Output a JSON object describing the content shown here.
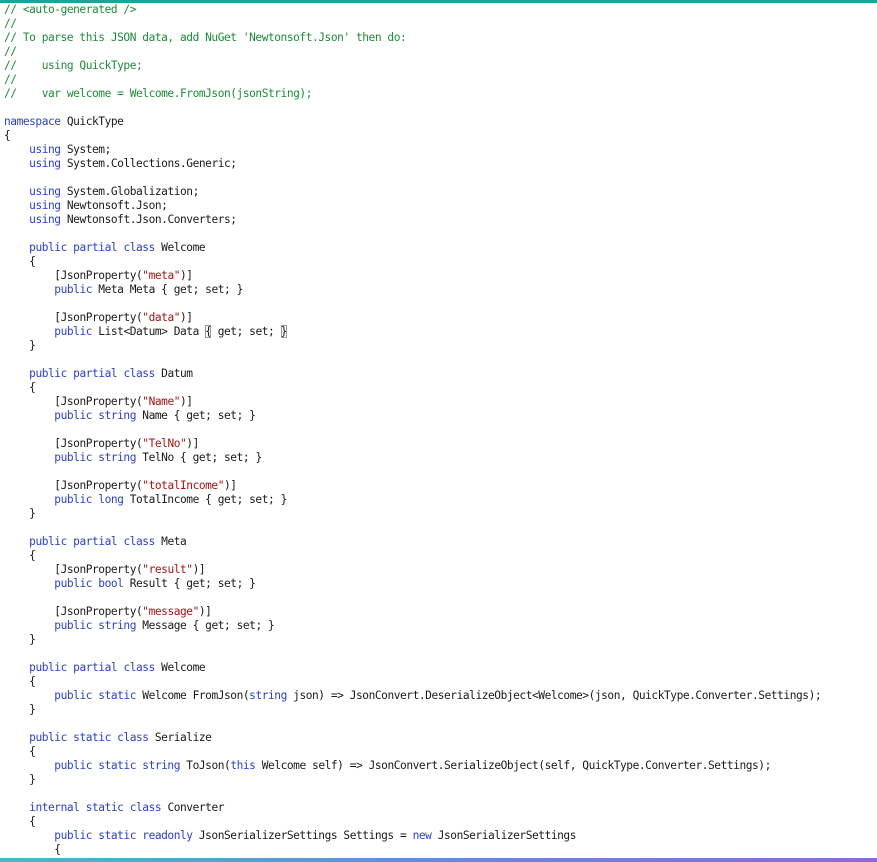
{
  "colors": {
    "accent_top": "#1fa398",
    "keyword": "#2b3fc8",
    "comment": "#1f8a3a",
    "string": "#a31515",
    "type": "#2b91af",
    "text": "#1a1a1a"
  },
  "code": {
    "lines": [
      {
        "indent": "",
        "tokens": [
          {
            "t": "// <auto-generated />",
            "c": "c"
          }
        ]
      },
      {
        "indent": "",
        "tokens": [
          {
            "t": "//",
            "c": "c"
          }
        ]
      },
      {
        "indent": "",
        "tokens": [
          {
            "t": "// To parse this JSON data, add NuGet 'Newtonsoft.Json' then do:",
            "c": "c"
          }
        ]
      },
      {
        "indent": "",
        "tokens": [
          {
            "t": "//",
            "c": "c"
          }
        ]
      },
      {
        "indent": "",
        "tokens": [
          {
            "t": "//    using QuickType;",
            "c": "c"
          }
        ]
      },
      {
        "indent": "",
        "tokens": [
          {
            "t": "//",
            "c": "c"
          }
        ]
      },
      {
        "indent": "",
        "tokens": [
          {
            "t": "//    var welcome = Welcome.FromJson(jsonString);",
            "c": "c"
          }
        ]
      },
      {
        "indent": "",
        "tokens": []
      },
      {
        "indent": "",
        "tokens": [
          {
            "t": "namespace",
            "c": "k"
          },
          {
            "t": " QuickType",
            "c": ""
          }
        ]
      },
      {
        "indent": "",
        "tokens": [
          {
            "t": "{",
            "c": ""
          }
        ]
      },
      {
        "indent": "    ",
        "tokens": [
          {
            "t": "using",
            "c": "k"
          },
          {
            "t": " System;",
            "c": ""
          }
        ]
      },
      {
        "indent": "    ",
        "tokens": [
          {
            "t": "using",
            "c": "k"
          },
          {
            "t": " System.Collections.Generic;",
            "c": ""
          }
        ]
      },
      {
        "indent": "",
        "tokens": []
      },
      {
        "indent": "    ",
        "tokens": [
          {
            "t": "using",
            "c": "k"
          },
          {
            "t": " System.Globalization;",
            "c": ""
          }
        ]
      },
      {
        "indent": "    ",
        "tokens": [
          {
            "t": "using",
            "c": "k"
          },
          {
            "t": " Newtonsoft.Json;",
            "c": ""
          }
        ]
      },
      {
        "indent": "    ",
        "tokens": [
          {
            "t": "using",
            "c": "k"
          },
          {
            "t": " Newtonsoft.Json.Converters;",
            "c": ""
          }
        ]
      },
      {
        "indent": "",
        "tokens": []
      },
      {
        "indent": "    ",
        "tokens": [
          {
            "t": "public partial class",
            "c": "k"
          },
          {
            "t": " Welcome",
            "c": ""
          }
        ]
      },
      {
        "indent": "    ",
        "tokens": [
          {
            "t": "{",
            "c": ""
          }
        ]
      },
      {
        "indent": "        ",
        "tokens": [
          {
            "t": "[JsonProperty(",
            "c": ""
          },
          {
            "t": "\"meta\"",
            "c": "s"
          },
          {
            "t": ")]",
            "c": ""
          }
        ]
      },
      {
        "indent": "        ",
        "tokens": [
          {
            "t": "public",
            "c": "k"
          },
          {
            "t": " Meta Meta { get; set; }",
            "c": ""
          }
        ]
      },
      {
        "indent": "",
        "tokens": []
      },
      {
        "indent": "        ",
        "tokens": [
          {
            "t": "[JsonProperty(",
            "c": ""
          },
          {
            "t": "\"data\"",
            "c": "s"
          },
          {
            "t": ")]",
            "c": ""
          }
        ]
      },
      {
        "indent": "        ",
        "tokens": [
          {
            "t": "public",
            "c": "k"
          },
          {
            "t": " List<Datum> Data ",
            "c": ""
          },
          {
            "t": "{",
            "c": "box"
          },
          {
            "t": " get; set; ",
            "c": ""
          },
          {
            "t": "}",
            "c": "box"
          }
        ]
      },
      {
        "indent": "    ",
        "tokens": [
          {
            "t": "}",
            "c": ""
          }
        ]
      },
      {
        "indent": "",
        "tokens": []
      },
      {
        "indent": "    ",
        "tokens": [
          {
            "t": "public partial class",
            "c": "k"
          },
          {
            "t": " Datum",
            "c": ""
          }
        ]
      },
      {
        "indent": "    ",
        "tokens": [
          {
            "t": "{",
            "c": ""
          }
        ]
      },
      {
        "indent": "        ",
        "tokens": [
          {
            "t": "[JsonProperty(",
            "c": ""
          },
          {
            "t": "\"Name\"",
            "c": "s"
          },
          {
            "t": ")]",
            "c": ""
          }
        ]
      },
      {
        "indent": "        ",
        "tokens": [
          {
            "t": "public string",
            "c": "k"
          },
          {
            "t": " Name { get; set; }",
            "c": ""
          }
        ]
      },
      {
        "indent": "",
        "tokens": []
      },
      {
        "indent": "        ",
        "tokens": [
          {
            "t": "[JsonProperty(",
            "c": ""
          },
          {
            "t": "\"TelNo\"",
            "c": "s"
          },
          {
            "t": ")]",
            "c": ""
          }
        ]
      },
      {
        "indent": "        ",
        "tokens": [
          {
            "t": "public string",
            "c": "k"
          },
          {
            "t": " TelNo { get; set; }",
            "c": ""
          }
        ]
      },
      {
        "indent": "",
        "tokens": []
      },
      {
        "indent": "        ",
        "tokens": [
          {
            "t": "[JsonProperty(",
            "c": ""
          },
          {
            "t": "\"totalIncome\"",
            "c": "s"
          },
          {
            "t": ")]",
            "c": ""
          }
        ]
      },
      {
        "indent": "        ",
        "tokens": [
          {
            "t": "public long",
            "c": "k"
          },
          {
            "t": " TotalIncome { get; set; }",
            "c": ""
          }
        ]
      },
      {
        "indent": "    ",
        "tokens": [
          {
            "t": "}",
            "c": ""
          }
        ]
      },
      {
        "indent": "",
        "tokens": []
      },
      {
        "indent": "    ",
        "tokens": [
          {
            "t": "public partial class",
            "c": "k"
          },
          {
            "t": " Meta",
            "c": ""
          }
        ]
      },
      {
        "indent": "    ",
        "tokens": [
          {
            "t": "{",
            "c": ""
          }
        ]
      },
      {
        "indent": "        ",
        "tokens": [
          {
            "t": "[JsonProperty(",
            "c": ""
          },
          {
            "t": "\"result\"",
            "c": "s"
          },
          {
            "t": ")]",
            "c": ""
          }
        ]
      },
      {
        "indent": "        ",
        "tokens": [
          {
            "t": "public bool",
            "c": "k"
          },
          {
            "t": " Result { get; set; }",
            "c": ""
          }
        ]
      },
      {
        "indent": "",
        "tokens": []
      },
      {
        "indent": "        ",
        "tokens": [
          {
            "t": "[JsonProperty(",
            "c": ""
          },
          {
            "t": "\"message\"",
            "c": "s"
          },
          {
            "t": ")]",
            "c": ""
          }
        ]
      },
      {
        "indent": "        ",
        "tokens": [
          {
            "t": "public string",
            "c": "k"
          },
          {
            "t": " Message { get; set; }",
            "c": ""
          }
        ]
      },
      {
        "indent": "    ",
        "tokens": [
          {
            "t": "}",
            "c": ""
          }
        ]
      },
      {
        "indent": "",
        "tokens": []
      },
      {
        "indent": "    ",
        "tokens": [
          {
            "t": "public partial class",
            "c": "k"
          },
          {
            "t": " Welcome",
            "c": ""
          }
        ]
      },
      {
        "indent": "    ",
        "tokens": [
          {
            "t": "{",
            "c": ""
          }
        ]
      },
      {
        "indent": "        ",
        "tokens": [
          {
            "t": "public static",
            "c": "k"
          },
          {
            "t": " Welcome FromJson(",
            "c": ""
          },
          {
            "t": "string",
            "c": "k"
          },
          {
            "t": " json) => JsonConvert.DeserializeObject<Welcome>(json, QuickType.Converter.Settings);",
            "c": ""
          }
        ]
      },
      {
        "indent": "    ",
        "tokens": [
          {
            "t": "}",
            "c": ""
          }
        ]
      },
      {
        "indent": "",
        "tokens": []
      },
      {
        "indent": "    ",
        "tokens": [
          {
            "t": "public static class",
            "c": "k"
          },
          {
            "t": " Serialize",
            "c": ""
          }
        ]
      },
      {
        "indent": "    ",
        "tokens": [
          {
            "t": "{",
            "c": ""
          }
        ]
      },
      {
        "indent": "        ",
        "tokens": [
          {
            "t": "public static string",
            "c": "k"
          },
          {
            "t": " ToJson(",
            "c": ""
          },
          {
            "t": "this",
            "c": "k"
          },
          {
            "t": " Welcome self) => JsonConvert.SerializeObject(self, QuickType.Converter.Settings);",
            "c": ""
          }
        ]
      },
      {
        "indent": "    ",
        "tokens": [
          {
            "t": "}",
            "c": ""
          }
        ]
      },
      {
        "indent": "",
        "tokens": []
      },
      {
        "indent": "    ",
        "tokens": [
          {
            "t": "internal static class",
            "c": "k"
          },
          {
            "t": " Converter",
            "c": ""
          }
        ]
      },
      {
        "indent": "    ",
        "tokens": [
          {
            "t": "{",
            "c": ""
          }
        ]
      },
      {
        "indent": "        ",
        "tokens": [
          {
            "t": "public static readonly",
            "c": "k"
          },
          {
            "t": " JsonSerializerSettings Settings = ",
            "c": ""
          },
          {
            "t": "new",
            "c": "k"
          },
          {
            "t": " JsonSerializerSettings",
            "c": ""
          }
        ]
      },
      {
        "indent": "        ",
        "tokens": [
          {
            "t": "{",
            "c": ""
          }
        ]
      }
    ]
  }
}
